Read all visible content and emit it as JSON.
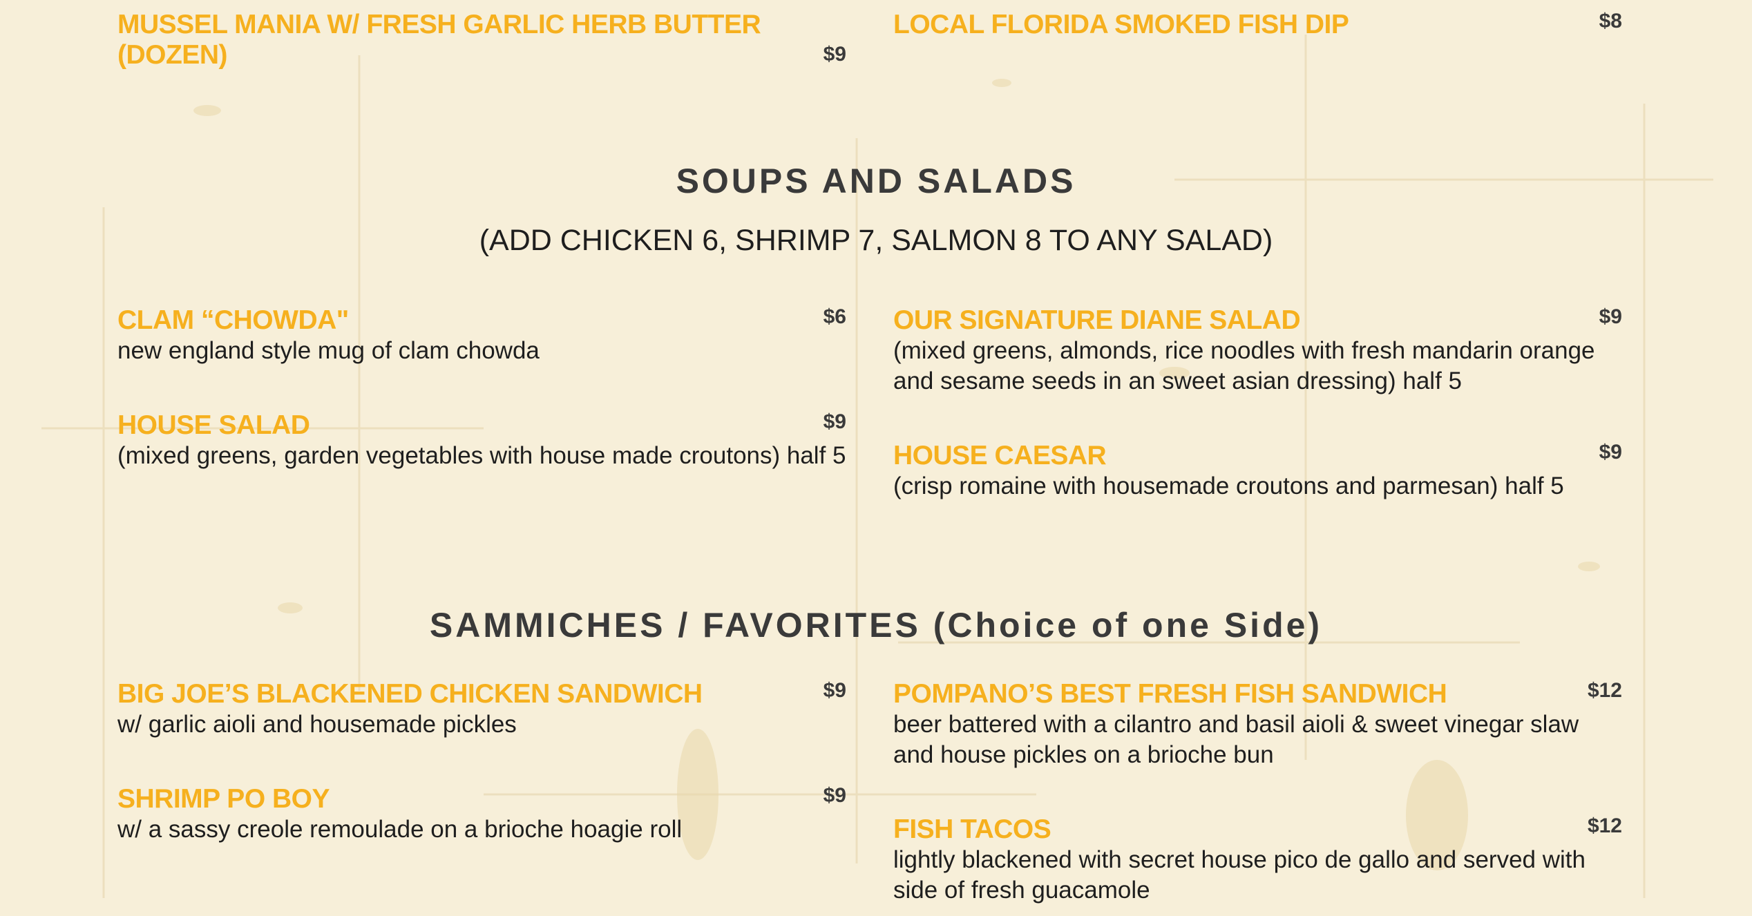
{
  "colors": {
    "background": "#f7efd9",
    "item_name": "#f6b01e",
    "price": "#3a3a3a",
    "heading": "#3a3a3a",
    "text": "#1e1e1e"
  },
  "top_items": {
    "left": {
      "name": "MUSSEL MANIA W/ FRESH GARLIC HERB BUTTER (DOZEN)",
      "price": "$9"
    },
    "right": {
      "name": "LOCAL FLORIDA SMOKED FISH DIP",
      "price": "$8"
    }
  },
  "soups_salads": {
    "title": "SOUPS AND SALADS",
    "note": "(ADD CHICKEN 6, SHRIMP 7, SALMON 8 TO ANY SALAD)",
    "items": [
      {
        "name": "CLAM “CHOWDA\"",
        "price": "$6",
        "desc": "new england style mug of clam chowda"
      },
      {
        "name": "OUR SIGNATURE DIANE SALAD",
        "price": "$9",
        "desc": "(mixed greens, almonds, rice noodles with fresh mandarin orange and sesame seeds in an sweet asian dressing) half 5"
      },
      {
        "name": "HOUSE SALAD",
        "price": "$9",
        "desc": "(mixed greens, garden vegetables with house made croutons) half 5"
      },
      {
        "name": "HOUSE CAESAR",
        "price": "$9",
        "desc": "(crisp romaine with housemade croutons and parmesan) half 5"
      }
    ]
  },
  "sammiches": {
    "title": "SAMMICHES / FAVORITES (Choice of one Side)",
    "items": [
      {
        "name": "BIG JOE’S BLACKENED CHICKEN SANDWICH",
        "price": "$9",
        "desc": "w/ garlic aioli and housemade pickles"
      },
      {
        "name": "POMPANO’S BEST FRESH FISH SANDWICH",
        "price": "$12",
        "desc": "beer battered with a cilantro and basil aioli & sweet vinegar slaw and house pickles on a brioche bun"
      },
      {
        "name": "SHRIMP PO BOY",
        "price": "$9",
        "desc": "w/ a sassy creole remoulade on a brioche hoagie roll"
      },
      {
        "name": "FISH TACOS",
        "price": "$12",
        "desc": "lightly blackened with secret house pico de gallo and served with side of fresh guacamole"
      }
    ]
  }
}
